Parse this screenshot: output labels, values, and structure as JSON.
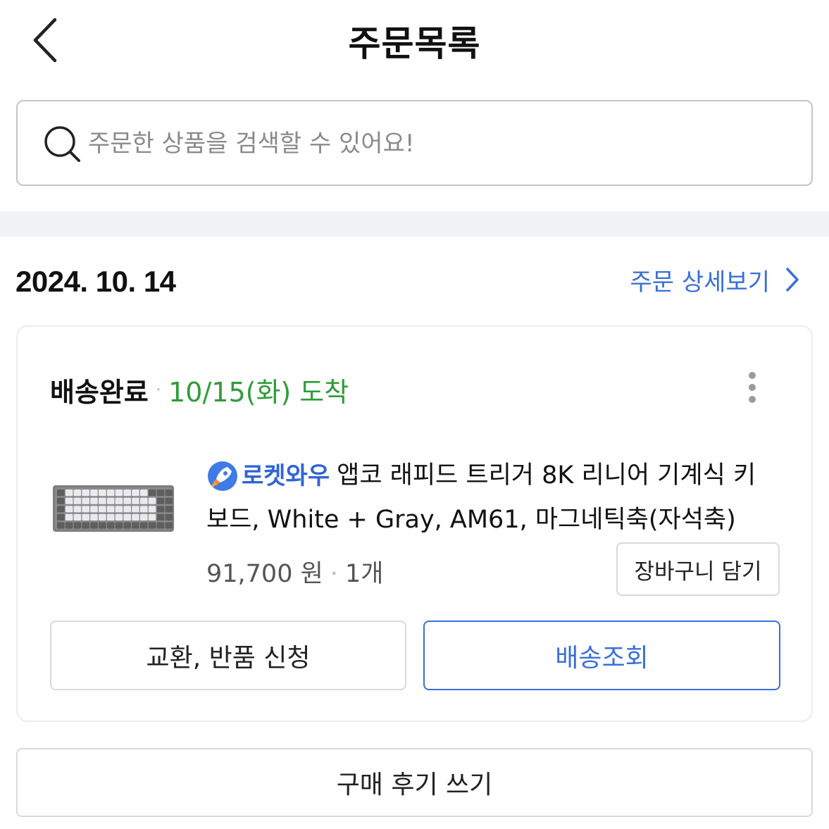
{
  "header": {
    "title": "주문목록",
    "back_icon": "chevron-left-icon"
  },
  "search": {
    "placeholder": "주문한 상품을 검색할 수 있어요!",
    "value": "",
    "icon": "search-icon"
  },
  "order": {
    "date": "2024. 10. 14",
    "detail_link_label": "주문 상세보기",
    "status": "배송완료",
    "status_separator": "·",
    "arrival": "10/15(화) 도착",
    "badge": {
      "text": "로켓와우",
      "icon": "rocket-icon"
    },
    "product_name": "앱코 래피드 트리거 8K 리니어 기계식 키보드, White + Gray, AM61, 마그네틱축(자석축)",
    "price": "91,700 원",
    "price_separator": "·",
    "quantity": "1개",
    "cart_button_label": "장바구니 담기",
    "return_button_label": "교환, 반품 신청",
    "track_button_label": "배송조회"
  },
  "review_button_label": "구매 후기 쓰기",
  "colors": {
    "accent_blue": "#3a6fd8",
    "arrival_green": "#2e9c3a",
    "divider_gray": "#f1f2f4"
  }
}
